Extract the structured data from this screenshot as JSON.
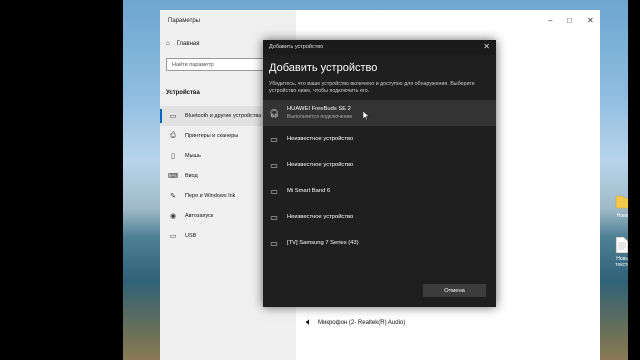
{
  "desktop": {
    "icons": [
      {
        "label": "Новая",
        "icon": "folder-icon"
      },
      {
        "label": "Новый текстов",
        "icon": "text-file-icon"
      }
    ]
  },
  "settings": {
    "title": "Параметры",
    "home_label": "Главная",
    "search_placeholder": "Найти параметр",
    "section_title": "Устройства",
    "nav": [
      {
        "label": "Bluetooth и другие устройства",
        "icon": "bluetooth-icon"
      },
      {
        "label": "Принтеры и сканеры",
        "icon": "printer-icon"
      },
      {
        "label": "Мышь",
        "icon": "mouse-icon"
      },
      {
        "label": "Ввод",
        "icon": "keyboard-icon"
      },
      {
        "label": "Перо и Windows Ink",
        "icon": "pen-icon"
      },
      {
        "label": "Автозапуск",
        "icon": "autoplay-icon"
      },
      {
        "label": "USB",
        "icon": "usb-icon"
      }
    ],
    "microphone_label": "Микрофон (2- Realtek(R) Audio)"
  },
  "dialog": {
    "caption": "Добавить устройство",
    "heading": "Добавить устройство",
    "description": "Убедитесь, что ваше устройство включено и доступно для обнаружения. Выберите устройство ниже, чтобы подключить его.",
    "devices": [
      {
        "name": "HUAWEI FreeBuds SE 2",
        "status": "Выполняется подключение",
        "icon": "headphones-icon"
      },
      {
        "name": "Неизвестное устройство",
        "status": "",
        "icon": "display-icon"
      },
      {
        "name": "Неизвестное устройство",
        "status": "",
        "icon": "display-icon"
      },
      {
        "name": "Mi Smart Band 6",
        "status": "",
        "icon": "display-icon"
      },
      {
        "name": "Неизвестное устройство",
        "status": "",
        "icon": "display-icon"
      },
      {
        "name": "[TV] Samsung 7 Series (43)",
        "status": "",
        "icon": "display-icon"
      }
    ],
    "cancel_label": "Отмена"
  }
}
